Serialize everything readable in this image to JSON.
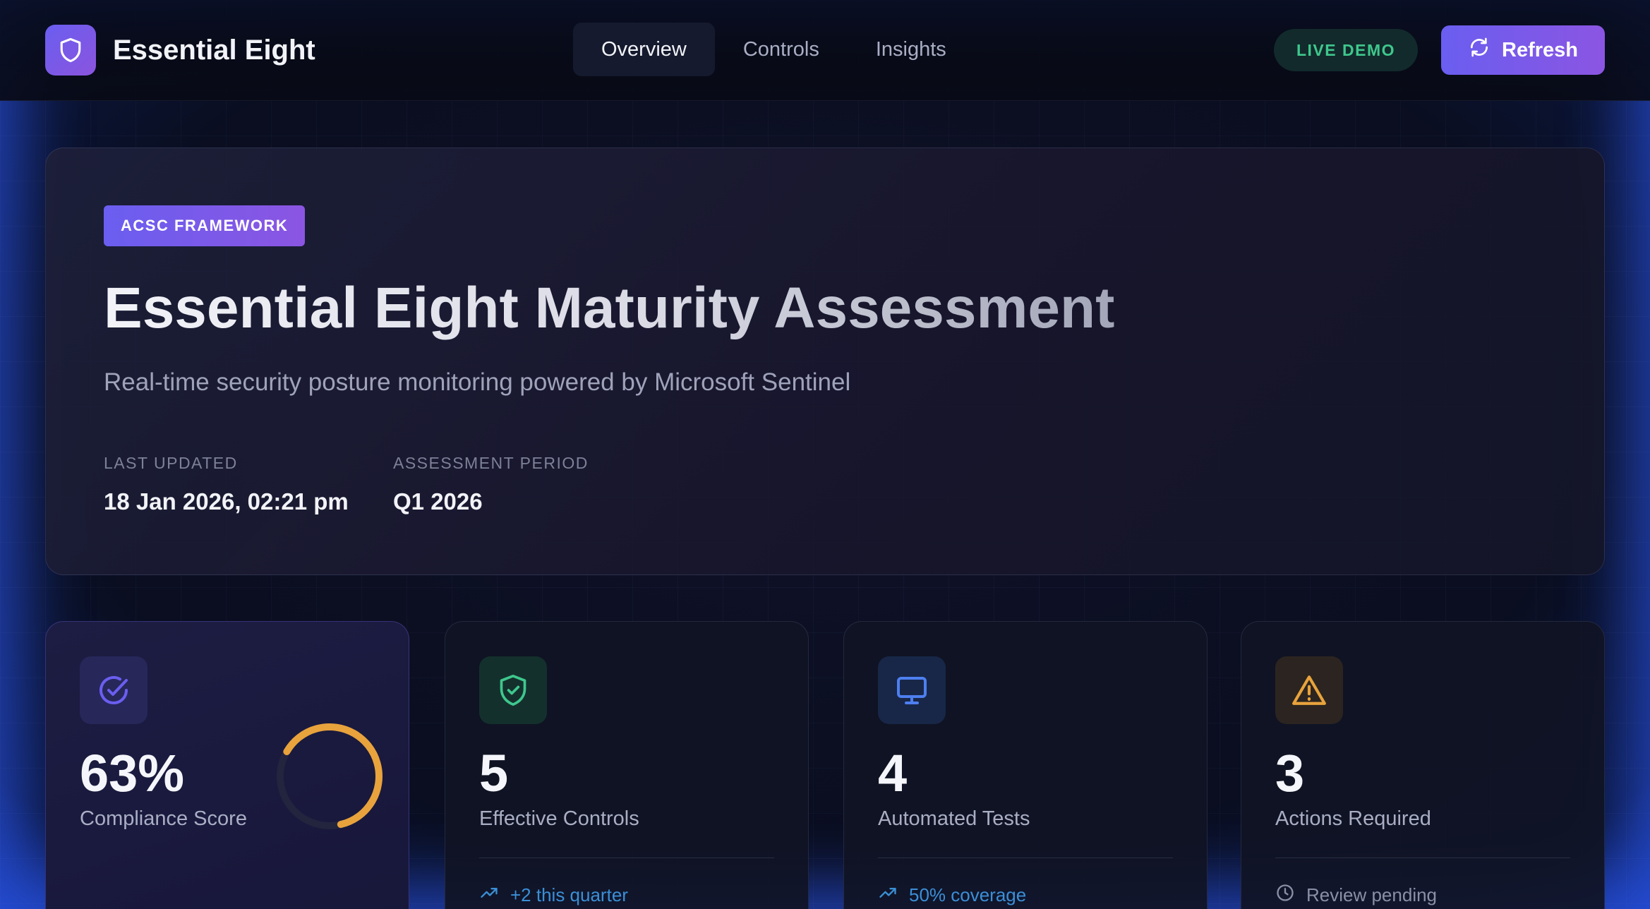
{
  "app": {
    "name": "Essential Eight",
    "logo_icon": "shield-icon"
  },
  "nav": {
    "tabs": [
      {
        "label": "Overview",
        "active": true
      },
      {
        "label": "Controls",
        "active": false
      },
      {
        "label": "Insights",
        "active": false
      }
    ]
  },
  "header": {
    "live_badge": "LIVE DEMO",
    "refresh_label": "Refresh",
    "refresh_icon": "refresh-icon"
  },
  "hero": {
    "badge": "ACSC FRAMEWORK",
    "title": "Essential Eight Maturity Assessment",
    "subtitle": "Real-time security posture monitoring powered by Microsoft Sentinel",
    "meta": [
      {
        "label": "LAST UPDATED",
        "value": "18 Jan 2026, 02:21 pm"
      },
      {
        "label": "ASSESSMENT PERIOD",
        "value": "Q1 2026"
      }
    ]
  },
  "stats": [
    {
      "icon": "check-circle-icon",
      "value": "63%",
      "label": "Compliance Score",
      "progress": 0.63,
      "accent": "#e8a33c",
      "icon_color": "#6a5ef0"
    },
    {
      "icon": "shield-check-icon",
      "value": "5",
      "label": "Effective Controls",
      "foot": "+2 this quarter",
      "foot_icon": "trend-up-icon",
      "icon_color": "#3fc78d",
      "foot_color": "#3b8fd6"
    },
    {
      "icon": "monitor-icon",
      "value": "4",
      "label": "Automated Tests",
      "foot": "50% coverage",
      "foot_icon": "trend-up-icon",
      "icon_color": "#4d7ff0",
      "foot_color": "#3b8fd6"
    },
    {
      "icon": "warning-icon",
      "value": "3",
      "label": "Actions Required",
      "foot": "Review pending",
      "foot_icon": "clock-icon",
      "icon_color": "#e8a33c",
      "foot_color": "#8b8fa6"
    }
  ]
}
